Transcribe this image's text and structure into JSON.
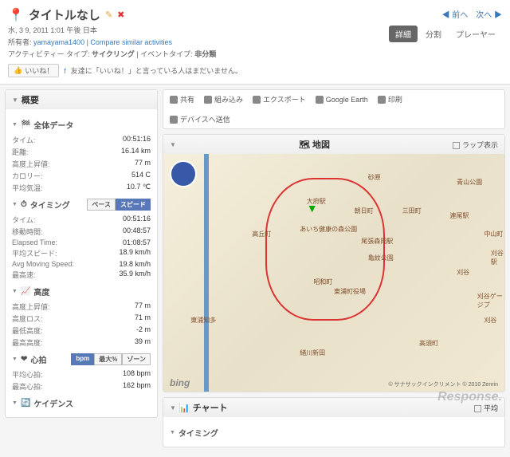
{
  "header": {
    "title": "タイトルなし",
    "date": "水, 3 9, 2011 1:01 午後 日本",
    "owner_label": "所有者:",
    "owner": "yamayama1400",
    "compare": "Compare similar activities",
    "activity_type_label": "アクティビティー タイプ:",
    "activity_type": "サイクリング",
    "event_type_label": "イベントタイプ:",
    "event_type": "非分類",
    "like_btn": "いいね！",
    "like_text": "友達に「いいね！」と言っている人はまだいません。"
  },
  "nav": {
    "prev": "◀ 前へ",
    "next": "次へ ▶"
  },
  "tabs": {
    "detail": "詳細",
    "split": "分割",
    "player": "プレーヤー"
  },
  "summary": {
    "title": "概要",
    "overall": {
      "title": "全体データ",
      "rows": [
        {
          "l": "タイム:",
          "v": "00:51:16"
        },
        {
          "l": "距離:",
          "v": "16.14 km"
        },
        {
          "l": "高度上昇値:",
          "v": "77 m"
        },
        {
          "l": "カロリー:",
          "v": "514 C"
        },
        {
          "l": "平均気温:",
          "v": "10.7 ℃"
        }
      ]
    },
    "timing": {
      "title": "タイミング",
      "toggle": {
        "pace": "ペース",
        "speed": "スピード"
      },
      "rows": [
        {
          "l": "タイム:",
          "v": "00:51:16"
        },
        {
          "l": "移動時間:",
          "v": "00:48:57"
        },
        {
          "l": "Elapsed Time:",
          "v": "01:08:57"
        },
        {
          "l": "平均スピード:",
          "v": "18.9 km/h"
        },
        {
          "l": "Avg Moving Speed:",
          "v": "19.8 km/h"
        },
        {
          "l": "最高速:",
          "v": "35.9 km/h"
        }
      ]
    },
    "elevation": {
      "title": "高度",
      "rows": [
        {
          "l": "高度上昇値:",
          "v": "77 m"
        },
        {
          "l": "高度ロス:",
          "v": "71 m"
        },
        {
          "l": "最低高度:",
          "v": "-2 m"
        },
        {
          "l": "最高高度:",
          "v": "39 m"
        }
      ]
    },
    "hr": {
      "title": "心拍",
      "toggle": {
        "bpm": "bpm",
        "max": "最大%",
        "zone": "ゾーン"
      },
      "rows": [
        {
          "l": "平均心拍:",
          "v": "108 bpm"
        },
        {
          "l": "最高心拍:",
          "v": "162 bpm"
        }
      ]
    },
    "cadence": {
      "title": "ケイデンス"
    }
  },
  "toolbar": {
    "share": "共有",
    "embed": "組み込み",
    "export": "エクスポート",
    "ge": "Google Earth",
    "print": "印刷",
    "send": "デバイスへ送信"
  },
  "map": {
    "title": "地図",
    "lap": "ラップ表示",
    "bing": "bing",
    "attr": "© サナサックインクリメント © 2010 Zenrin",
    "places": [
      "大府駅",
      "砂原",
      "青山公園",
      "朝日町",
      "三田町",
      "連尾駅",
      "あいち健康の森公園",
      "尾張森岡駅",
      "高丘町",
      "中山町",
      "刈谷駅",
      "亀紋公園",
      "昭和町",
      "刈谷",
      "東浦町役場",
      "東浦知多",
      "高須町",
      "刈谷ゲージプ",
      "刈谷",
      "緒川新田"
    ]
  },
  "chart": {
    "title": "チャート",
    "avg": "平均",
    "timing": "タイミング"
  },
  "watermark": "Response."
}
